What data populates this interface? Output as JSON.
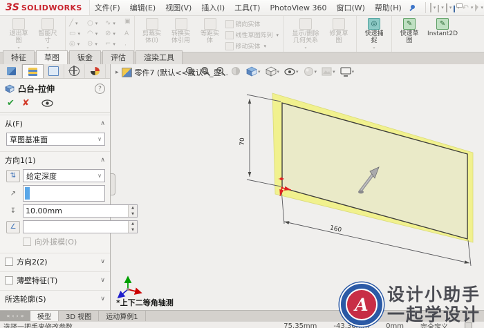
{
  "icons": {
    "caret": "▾",
    "chevron_up": "∧",
    "chevron_down": "∨",
    "check": "✔",
    "cancel": "✘",
    "expand": "▸",
    "spin_up": "▲",
    "spin_down": "▼",
    "nav": [
      "«",
      "‹",
      "›",
      "»"
    ]
  },
  "logo": {
    "mark": "3S",
    "word": "SOLIDWORKS"
  },
  "menubar": {
    "items": [
      "文件(F)",
      "编辑(E)",
      "视图(V)",
      "插入(I)",
      "工具(T)",
      "PhotoView 360",
      "窗口(W)",
      "帮助(H)"
    ]
  },
  "quickbar": {
    "icons": [
      "new-document",
      "open",
      "save",
      "print",
      "undo",
      "select",
      "rebuild",
      "options",
      "file-explorer"
    ],
    "undo_glyph": "↶",
    "rebuild_glyph": "↻",
    "options_glyph": "⚙"
  },
  "ribbon": {
    "exit_sketch": [
      "退出草",
      "图"
    ],
    "smart_dimension": [
      "智能尺",
      "寸"
    ],
    "sketch_glyphs": [
      "╱",
      "○",
      "∿",
      "▭",
      "◠",
      "⊘",
      "◎",
      "⊙",
      "⌐"
    ],
    "side_glyphs": [
      "▣",
      "A",
      "·"
    ],
    "trim_entities": [
      "剪裁实",
      "体(I)"
    ],
    "convert_entities": [
      "转换实",
      "体引用"
    ],
    "offset_entities": [
      "等距实",
      "体"
    ],
    "mirror_entities": "镜向实体",
    "linear_pattern": "线性草图阵列",
    "move_entities": "移动实体",
    "display_relations": [
      "显示/删除",
      "几何关系"
    ],
    "repair_sketch": [
      "修复草",
      "图"
    ],
    "quick_snaps": [
      "快速捕",
      "捉"
    ],
    "rapid_sketch": [
      "快速草",
      "图"
    ],
    "instant2d": "Instant2D"
  },
  "command_tabs": {
    "items": [
      "特征",
      "草图",
      "钣金",
      "评估",
      "渲染工具"
    ],
    "active": "草图"
  },
  "property_panel": {
    "title": "凸台-拉伸",
    "help": "?",
    "from_label": "从(F)",
    "from_value": "草图基准面",
    "dir1_label": "方向1(1)",
    "dir1_end_condition": "给定深度",
    "dir1_depth": "10.00mm",
    "dir1_draft": "",
    "outward_draft_label": "向外拔模(O)",
    "dir2_label": "方向2(2)",
    "thin_label": "薄壁特征(T)",
    "contours_label": "所选轮廓(S)"
  },
  "viewport": {
    "tree_item": "零件7 (默认<<默认>_显...",
    "view_label": "*上下二等角轴测",
    "headsup_icons": [
      "zoom-fit",
      "zoom-area",
      "previous-view",
      "section-view",
      "view-orientation",
      "display-style",
      "hide-show-items",
      "edit-appearance",
      "apply-scene",
      "view-settings"
    ],
    "dim_height": "70",
    "dim_width": "160"
  },
  "bottom_bar": {
    "tabs": [
      "模型",
      "3D 视图",
      "运动算例1"
    ],
    "active": "模型"
  },
  "statusbar": {
    "message": "选择一把手来修改参数",
    "x": "75.35mm",
    "y": "-43.36mm",
    "z": "0mm",
    "state": "完全定义"
  },
  "watermark": {
    "monogram": "A",
    "line1": "设计小助手",
    "line2": "一起学设计"
  },
  "colors": {
    "accent_red": "#c8242e",
    "logo_blue": "#1d4fa1",
    "plate_fill": "#eaeac8",
    "plate_rim": "#f1f18e",
    "origin_red": "#e02020",
    "triad_x": "#cc0000",
    "triad_y": "#00a000",
    "triad_z": "#2020cc"
  }
}
